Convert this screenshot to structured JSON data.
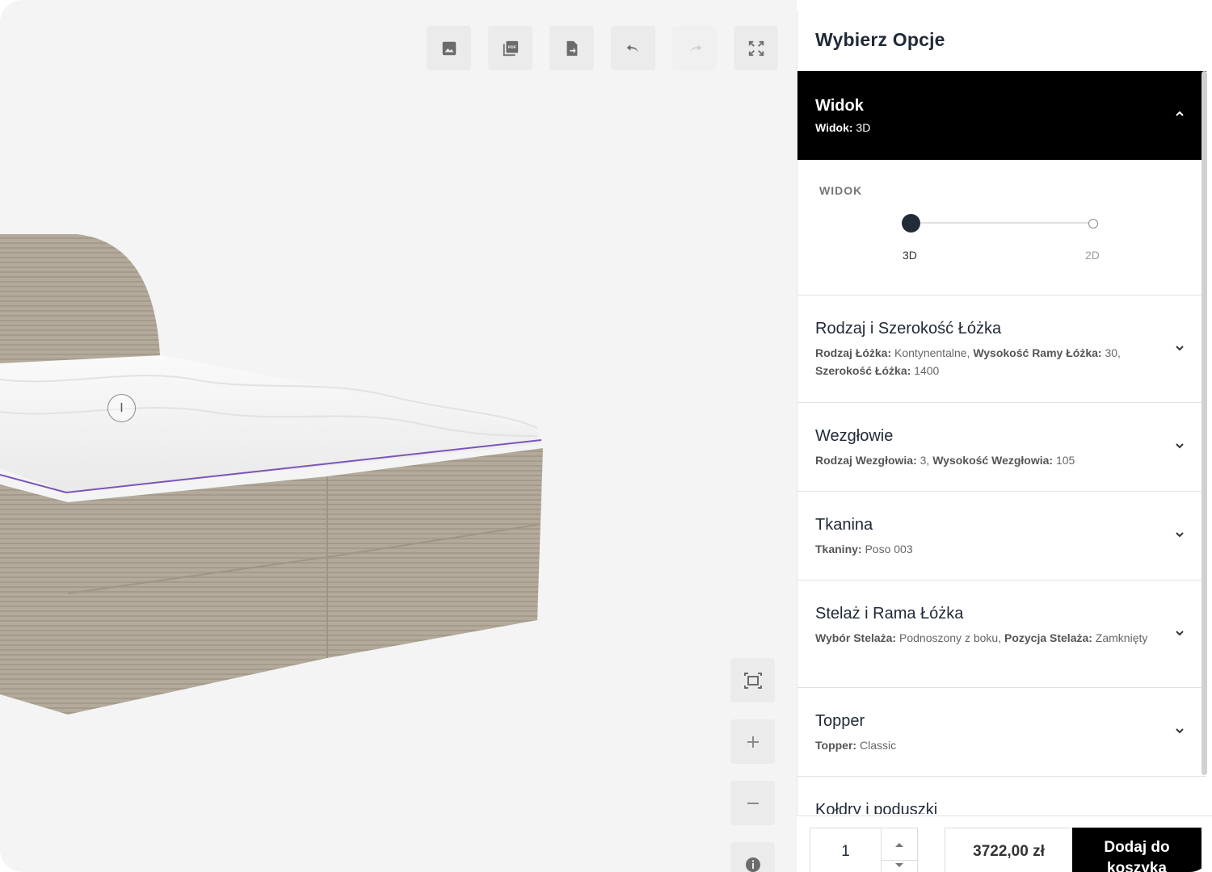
{
  "toolbar": {
    "buttons": [
      {
        "name": "image-download",
        "icon": "image-icon"
      },
      {
        "name": "pdf-export",
        "icon": "pdf-icon"
      },
      {
        "name": "file-export",
        "icon": "file-export-icon"
      },
      {
        "name": "undo",
        "icon": "undo-icon"
      },
      {
        "name": "redo",
        "icon": "redo-icon"
      },
      {
        "name": "fullscreen",
        "icon": "fullscreen-icon"
      }
    ]
  },
  "viewer": {
    "hotspot_label": "I"
  },
  "panel": {
    "title": "Wybierz Opcje",
    "active_section": {
      "title": "Widok",
      "summary_key": "Widok:",
      "summary_value": " 3D",
      "option_label": "WIDOK",
      "options": [
        "3D",
        "2D"
      ],
      "selected": "3D"
    },
    "sections": [
      {
        "title": "Rodzaj i Szerokość Łóżka",
        "parts": [
          {
            "k": "Rodzaj Łóżka:",
            "v": " Kontynentalne, "
          },
          {
            "k": "Wysokość Ramy Łóżka:",
            "v": " 30, "
          },
          {
            "k": "Szerokość Łóżka:",
            "v": " 1400"
          }
        ]
      },
      {
        "title": "Wezgłowie",
        "parts": [
          {
            "k": "Rodzaj Wezgłowia:",
            "v": " 3, "
          },
          {
            "k": "Wysokość Wezgłowia:",
            "v": " 105"
          }
        ]
      },
      {
        "title": "Tkanina",
        "parts": [
          {
            "k": "Tkaniny:",
            "v": " Poso 003"
          }
        ]
      },
      {
        "title": "Stelaż i Rama Łóżka",
        "parts": [
          {
            "k": "Wybór Stelaża:",
            "v": " Podnoszony z boku, "
          },
          {
            "k": "Pozycja Stelaża:",
            "v": " Zamknięty"
          }
        ]
      },
      {
        "title": "Topper",
        "parts": [
          {
            "k": "Topper:",
            "v": " Classic"
          }
        ]
      },
      {
        "title": "Kołdry i poduszki",
        "parts": []
      }
    ]
  },
  "footer": {
    "quantity": "1",
    "price": "3722,00 zł",
    "add_to_cart": "Dodaj do koszyka"
  }
}
